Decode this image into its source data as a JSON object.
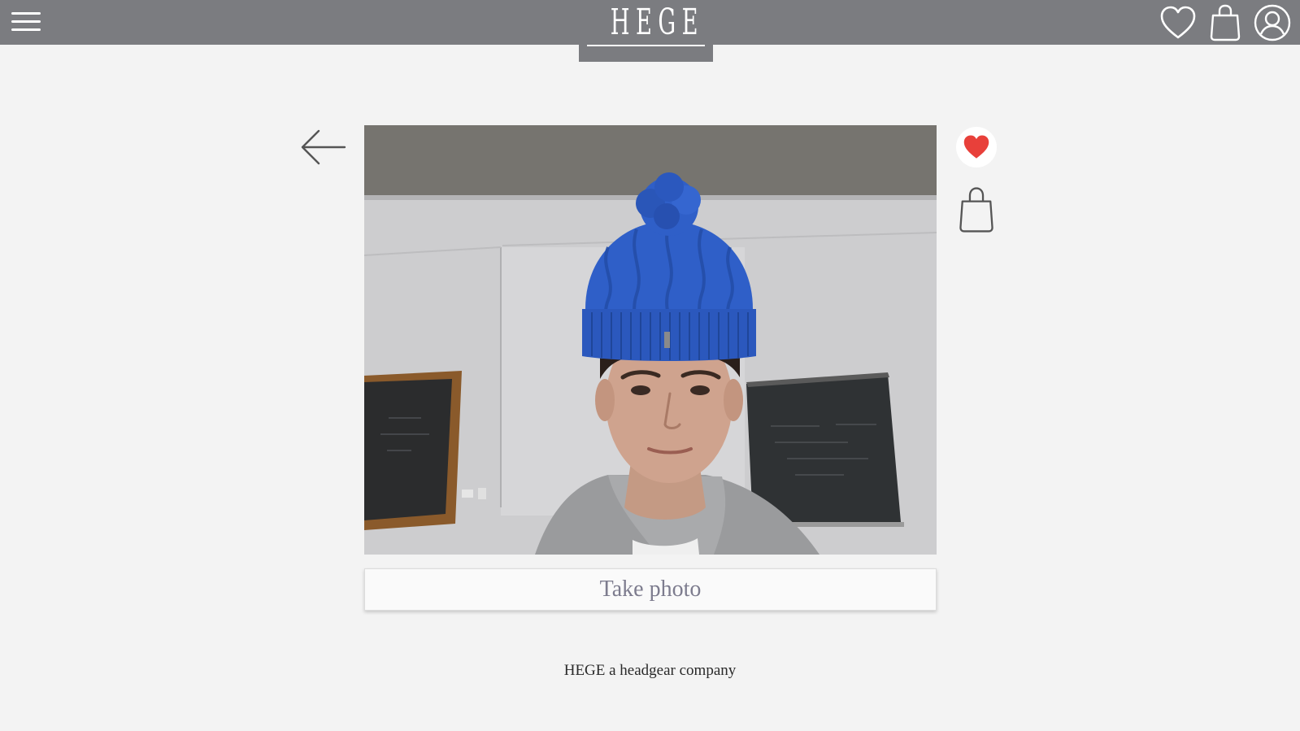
{
  "header": {
    "logo_text": "HEGE",
    "icons": [
      "menu-icon",
      "heart-icon",
      "shopping-bag-icon",
      "user-icon"
    ]
  },
  "main": {
    "take_photo_label": "Take photo",
    "icons": [
      "arrow-left-icon",
      "heart-filled-icon",
      "shopping-bag-icon"
    ]
  },
  "footer": {
    "tagline": "HEGE a headgear company"
  },
  "colors": {
    "header_bg": "#7b7c80",
    "page_bg": "#f3f3f3",
    "favorite_heart": "#e8403a",
    "button_text": "#7d7c8e",
    "hat_blue": "#2f5fc8"
  }
}
